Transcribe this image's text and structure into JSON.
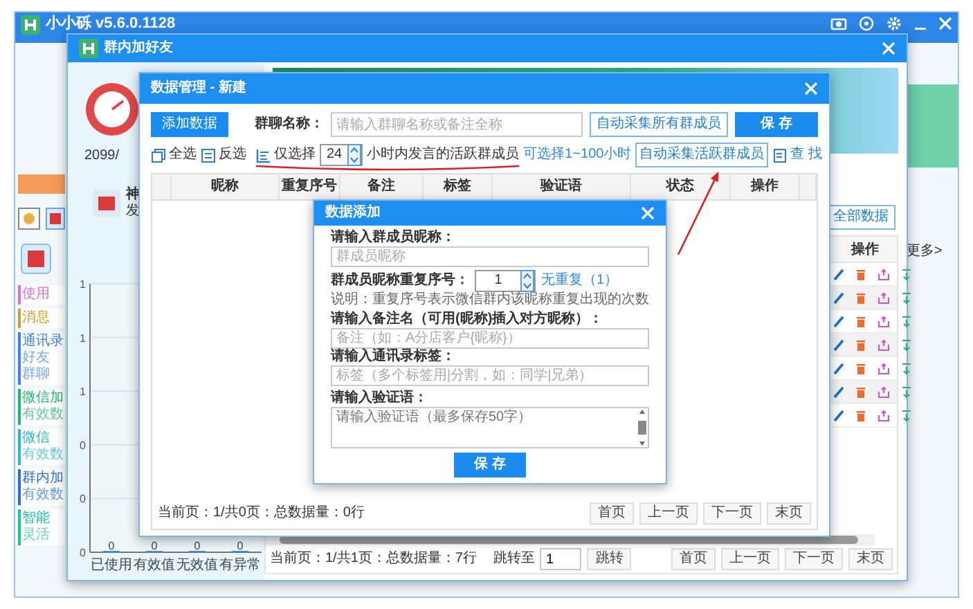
{
  "app": {
    "title": "小小砾  v5.6.0.1128",
    "sidebar": [
      {
        "title": "使用",
        "color": "#de6fd3"
      },
      {
        "title": "消息",
        "color": "#c9a227"
      },
      {
        "title": "通讯录",
        "color": "#3b82f6",
        "lines": [
          "好友",
          "群聊"
        ]
      },
      {
        "title": "微信加",
        "color": "#22b573",
        "lines": [
          "有效数"
        ]
      },
      {
        "title": "微信",
        "color": "#2bb5d8",
        "lines": [
          "有效数"
        ]
      },
      {
        "title": "群内加",
        "color": "#2a6fdb",
        "lines": [
          "有效数"
        ]
      },
      {
        "title": "智能",
        "color": "#20c0a0",
        "lines": [
          "灵活"
        ]
      }
    ],
    "more_link": "更多>"
  },
  "group_window": {
    "title": "群内加好友",
    "date": "2099/",
    "profile": {
      "name": "神",
      "subtitle": "发"
    },
    "chart_data": {
      "type": "bar",
      "grid": true,
      "categories": [
        "已使用",
        "有效值",
        "无效值",
        "有异常"
      ],
      "values": [
        0,
        0,
        0,
        0
      ],
      "data_labels": true,
      "ylim": [
        0,
        1
      ],
      "yticks": [
        {
          "value": 1,
          "label": "1"
        },
        {
          "value": 0.8,
          "label": "1"
        },
        {
          "value": 0.6,
          "label": "1"
        },
        {
          "value": 0.4,
          "label": "0"
        },
        {
          "value": 0.2,
          "label": "0"
        },
        {
          "value": 0,
          "label": "0"
        }
      ]
    },
    "all_data_button": "全部数据",
    "table": {
      "columns": [
        "操作"
      ],
      "rows": [
        {
          "shaded": false
        },
        {
          "shaded": true
        },
        {
          "shaded": false
        },
        {
          "shaded": true
        },
        {
          "shaded": false
        },
        {
          "shaded": true
        },
        {
          "shaded": false
        }
      ]
    },
    "pagination": {
      "summary": "当前页：1/共1页：总数据量：7行",
      "jump_label": "跳转至",
      "jump_value": "1",
      "jump_button": "跳转",
      "buttons": [
        "首页",
        "上一页",
        "下一页",
        "末页"
      ]
    }
  },
  "manager_dialog": {
    "title": "数据管理 - 新建",
    "add_button": "添加数据",
    "name_label": "群聊名称：",
    "name_field": {
      "placeholder": "请输入群聊名称或备注全称"
    },
    "collect_all_button": "自动采集所有群成员",
    "save_button": "保 存",
    "toolbar": [
      {
        "kind": "select_all",
        "label": "全选"
      },
      {
        "kind": "invert",
        "label": "反选"
      }
    ],
    "only_select": {
      "label": "仅选择",
      "hours": "24",
      "suffix": "小时内发言的活跃群成员",
      "hint": "可选择1~100小时"
    },
    "collect_active_button": "自动采集活跃群成员",
    "find_button": "查 找",
    "columns": [
      "昵称",
      "重复序号",
      "备注",
      "标签",
      "验证语",
      "状态",
      "操作"
    ],
    "footer": {
      "summary": "当前页：1/共0页：总数据量：0行",
      "buttons": [
        "首页",
        "上一页",
        "下一页",
        "末页"
      ]
    }
  },
  "add_dialog": {
    "title": "数据添加",
    "fields": [
      {
        "kind": "text",
        "label": "请输入群成员昵称：",
        "placeholder": "群成员昵称"
      },
      {
        "kind": "spin",
        "label": "群成员昵称重复序号：",
        "value": "1",
        "hint": "无重复（1）",
        "note": "说明：重复序号表示微信群内该昵称重复出现的次数"
      },
      {
        "kind": "text",
        "label": "请输入备注名（可用(昵称)插入对方昵称）：",
        "placeholder": "备注（如：A分店客户{昵称}）"
      },
      {
        "kind": "text",
        "label": "请输入通讯录标签：",
        "placeholder": "标签（多个标签用|分割，如：同学|兄弟）"
      },
      {
        "kind": "textarea",
        "label": "请输入验证语：",
        "placeholder": "请输入验证语（最多保存50字）"
      }
    ],
    "save_button": "保 存"
  },
  "annotations": {
    "underline": true,
    "arrow": true
  }
}
